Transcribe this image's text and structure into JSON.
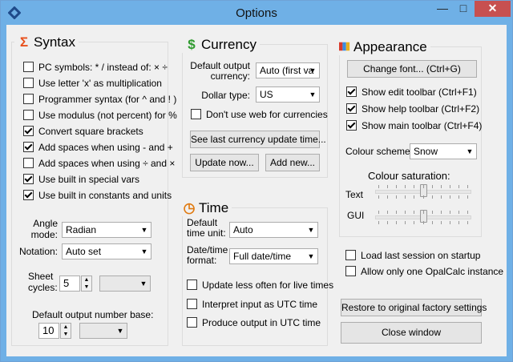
{
  "window": {
    "title": "Options",
    "minimize": "—",
    "maximize": "□",
    "close": "✕"
  },
  "syntax": {
    "heading": "Syntax",
    "icon": "Σ",
    "icon_color": "#e8501c",
    "options": [
      {
        "label": "PC symbols: * / instead of: × ÷",
        "checked": false
      },
      {
        "label": "Use letter 'x' as multiplication",
        "checked": false
      },
      {
        "label": "Programmer syntax (for ^ and ! )",
        "checked": false
      },
      {
        "label": "Use modulus (not percent) for %",
        "checked": false
      },
      {
        "label": "Convert square brackets",
        "checked": true
      },
      {
        "label": "Add spaces when using - and +",
        "checked": true
      },
      {
        "label": "Add spaces when using ÷ and ×",
        "checked": false
      },
      {
        "label": "Use built in special vars",
        "checked": true
      },
      {
        "label": "Use built in constants and units",
        "checked": true
      }
    ],
    "angle_mode_label": "Angle\nmode:",
    "angle_mode_value": "Radian",
    "notation_label": "Notation:",
    "notation_value": "Auto set",
    "sheet_cycles_label": "Sheet\ncycles:",
    "sheet_cycles_value": "5",
    "output_base_label": "Default output number base:",
    "output_base_value": "10"
  },
  "currency": {
    "heading": "Currency",
    "icon": "$",
    "icon_color": "#2e9a2e",
    "default_label": "Default output\ncurrency:",
    "default_value": "Auto (first va",
    "dollar_label": "Dollar type:",
    "dollar_value": "US",
    "no_web_label": "Don't use web for currencies",
    "no_web_checked": false,
    "see_last_button": "See last currency update time...",
    "update_button": "Update now...",
    "add_button": "Add new..."
  },
  "time": {
    "heading": "Time",
    "icon": "◷",
    "icon_color": "#e07a10",
    "unit_label": "Default\ntime unit:",
    "unit_value": "Auto",
    "format_label": "Date/time\nformat:",
    "format_value": "Full date/time",
    "options": [
      {
        "label": "Update less often for live times",
        "checked": false
      },
      {
        "label": "Interpret input as UTC time",
        "checked": false
      },
      {
        "label": "Produce output in UTC time",
        "checked": false
      }
    ]
  },
  "appearance": {
    "heading": "Appearance",
    "change_font_button": "Change font... (Ctrl+G)",
    "toolbars": [
      {
        "label": "Show edit toolbar (Ctrl+F1)",
        "checked": true
      },
      {
        "label": "Show help toolbar (Ctrl+F2)",
        "checked": true
      },
      {
        "label": "Show main toolbar (Ctrl+F4)",
        "checked": true
      }
    ],
    "colour_scheme_label": "Colour scheme",
    "colour_scheme_value": "Snow",
    "saturation_label": "Colour saturation:",
    "text_label": "Text",
    "gui_label": "GUI",
    "text_saturation": 0.5,
    "gui_saturation": 0.5
  },
  "footer": {
    "load_last_label": "Load last session on startup",
    "load_last_checked": false,
    "only_one_label": "Allow only one OpalCalc instance",
    "only_one_checked": false,
    "restore_button": "Restore to original factory settings",
    "close_button": "Close window"
  }
}
